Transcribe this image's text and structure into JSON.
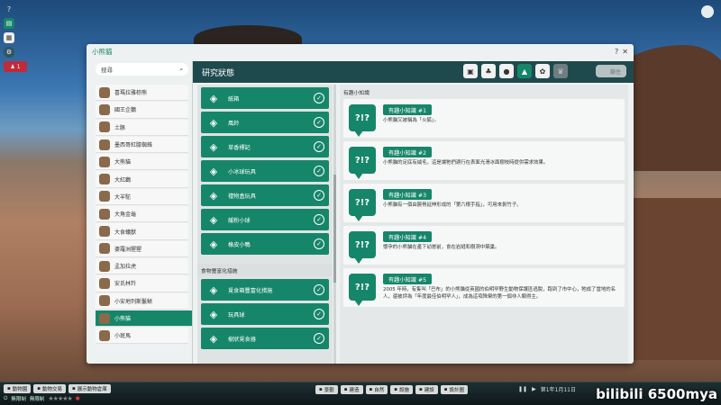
{
  "hud": {
    "help": "?",
    "badge": "1"
  },
  "window": {
    "title": "小熊貓",
    "help": "?",
    "close": "✕"
  },
  "search": {
    "placeholder": "搜尋"
  },
  "animals": [
    {
      "name": "喜瑪拉雅棕熊",
      "icon": "brown-bear-icon"
    },
    {
      "name": "國王企鵝",
      "icon": "penguin-icon"
    },
    {
      "name": "土豚",
      "icon": "aardvark-icon"
    },
    {
      "name": "墨西哥紅膝蜘蛛",
      "icon": "spider-icon"
    },
    {
      "name": "大熊貓",
      "icon": "panda-icon"
    },
    {
      "name": "大紅鸛",
      "icon": "flamingo-icon"
    },
    {
      "name": "大羊駝",
      "icon": "alpaca-icon"
    },
    {
      "name": "大角金龜",
      "icon": "beetle-icon"
    },
    {
      "name": "大食蟻獸",
      "icon": "anteater-icon"
    },
    {
      "name": "婆羅洲猩猩",
      "icon": "orangutan-icon"
    },
    {
      "name": "孟加拉虎",
      "icon": "tiger-icon"
    },
    {
      "name": "安氏林羚",
      "icon": "antelope-icon"
    },
    {
      "name": "小安地列斯鬣蜥",
      "icon": "iguana-icon"
    },
    {
      "name": "小熊貓",
      "icon": "red-panda-icon"
    },
    {
      "name": "小斑馬",
      "icon": "zebra-icon"
    }
  ],
  "selected_index": 13,
  "main": {
    "title": "研究狀態",
    "lock_label": "鎖住"
  },
  "tabs": [
    {
      "icon": "enclosure-icon",
      "glyph": "▣"
    },
    {
      "icon": "habitat-icon",
      "glyph": "♣"
    },
    {
      "icon": "food-icon",
      "glyph": "●"
    },
    {
      "icon": "enrichment-icon",
      "glyph": "▲"
    },
    {
      "icon": "welfare-icon",
      "glyph": "✿"
    },
    {
      "icon": "trophy-icon",
      "glyph": "♛"
    }
  ],
  "items": [
    {
      "label": "紙箱",
      "icon": "box-icon"
    },
    {
      "label": "風鈴",
      "icon": "chime-icon"
    },
    {
      "label": "草香標記",
      "icon": "scent-icon"
    },
    {
      "label": "小冰球玩具",
      "icon": "ice-ball-icon"
    },
    {
      "label": "禮物盒玩具",
      "icon": "gift-box-icon"
    },
    {
      "label": "緩粉小球",
      "icon": "ball-icon"
    },
    {
      "label": "橡皮小鴨",
      "icon": "duck-icon"
    }
  ],
  "food_group": {
    "heading": "食物豐富化措施",
    "items": [
      {
        "label": "覓食箱豐富化措施",
        "icon": "feeder-icon"
      },
      {
        "label": "玩具球",
        "icon": "toy-ball-icon"
      },
      {
        "label": "樹狀覓食器",
        "icon": "tree-feeder-icon"
      }
    ]
  },
  "facts_heading": "有趣小知識",
  "facts": [
    {
      "title": "有趣小知識 #1",
      "body": "小熊貓又被稱為「火狐」。"
    },
    {
      "title": "有趣小知識 #2",
      "body": "小熊貓的足底有絨毛，這是讓牠們適行在表面光滑冰面樹枝時提供需求效果。"
    },
    {
      "title": "有趣小知識 #3",
      "body": "小熊貓有一個由腕骨延伸形成的「第六根手指」，可用來剝竹子。"
    },
    {
      "title": "有趣小知識 #4",
      "body": "懷孕的小熊貓在產下幼崽前，會在岩縫和樹洞中築巢。"
    },
    {
      "title": "有趣小知識 #5",
      "body": "2005 年時，有隻叫「巴布」的小熊貓從英國的伯明罕野生動物保護區逃脫，跑到了市中心，牠成了當地的名人，還被評為「年度最佳伯明罕人」，成為這項殊榮的第一個非人類得主。"
    }
  ],
  "bottom": {
    "buttons": [
      "動物園",
      "動物交易",
      "展示動物倉庫"
    ],
    "mid": [
      "景觀",
      "建造",
      "自然",
      "設施",
      "建設",
      "設計圖"
    ],
    "left_low": [
      "無限制",
      "無限制"
    ],
    "date": "第1年1月11日"
  },
  "watermark": "bilibili 6500mya"
}
